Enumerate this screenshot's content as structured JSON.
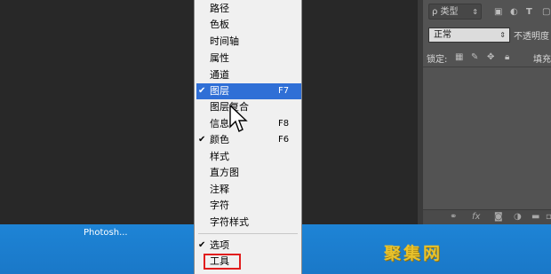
{
  "panel": {
    "search_label": "ρ 类型",
    "blend_mode": "正常",
    "opacity_label": "不透明度",
    "lock_label": "锁定:",
    "fill_label": "填充"
  },
  "taskbar": {
    "title": "Photosh...",
    "watermark": "聚集网"
  },
  "menu": {
    "items": [
      {
        "label": "路径",
        "shortcut": "",
        "checked": false
      },
      {
        "label": "色板",
        "shortcut": "",
        "checked": false
      },
      {
        "label": "时间轴",
        "shortcut": "",
        "checked": false
      },
      {
        "label": "属性",
        "shortcut": "",
        "checked": false
      },
      {
        "label": "通道",
        "shortcut": "",
        "checked": false
      },
      {
        "label": "图层",
        "shortcut": "F7",
        "checked": true
      },
      {
        "label": "图层复合",
        "shortcut": "",
        "checked": false
      },
      {
        "label": "信息",
        "shortcut": "F8",
        "checked": false
      },
      {
        "label": "颜色",
        "shortcut": "F6",
        "checked": true
      },
      {
        "label": "样式",
        "shortcut": "",
        "checked": false
      },
      {
        "label": "直方图",
        "shortcut": "",
        "checked": false
      },
      {
        "label": "注释",
        "shortcut": "",
        "checked": false
      },
      {
        "label": "字符",
        "shortcut": "",
        "checked": false
      },
      {
        "label": "字符样式",
        "shortcut": "",
        "checked": false
      },
      {
        "label": "选项",
        "shortcut": "",
        "checked": true
      },
      {
        "label": "工具",
        "shortcut": "",
        "checked": false
      }
    ],
    "check_glyph": "✔",
    "highlight_color": "#2f6fd6",
    "annotation_color": "#e11d1d"
  }
}
